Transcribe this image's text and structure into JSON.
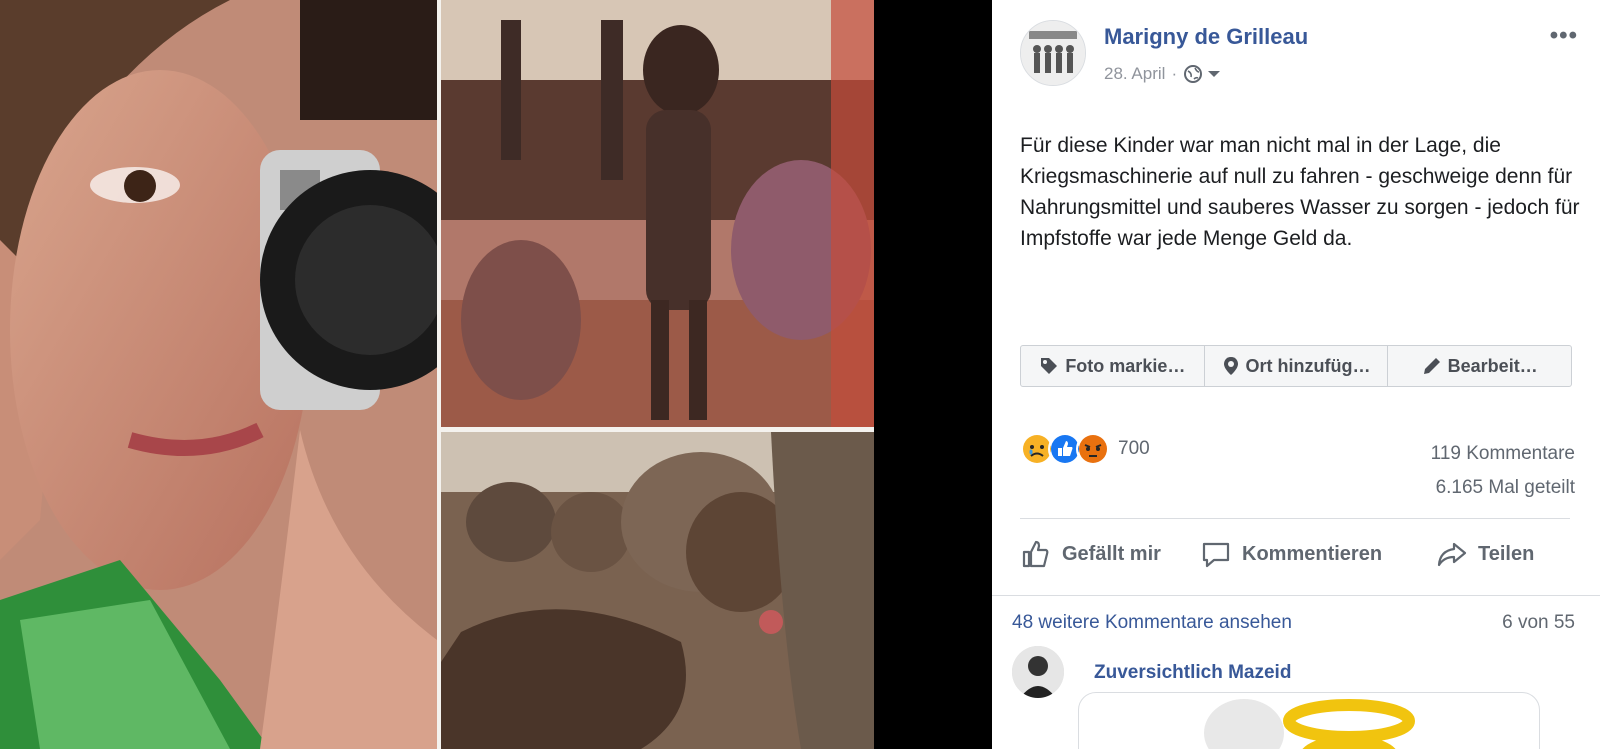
{
  "post": {
    "author": "Marigny de Grilleau",
    "date": "28. April",
    "date_separator": "·",
    "audience_icon": "globe-icon",
    "text": "Für diese Kinder war man nicht mal in der Lage, die Kriegsmaschinerie auf null zu fahren - geschweige denn für Nahrungsmittel und sauberes Wasser zu sorgen - jedoch für Impfstoffe war jede Menge Geld da."
  },
  "photo_actions": [
    {
      "label": "Foto markie…",
      "icon": "tag-icon"
    },
    {
      "label": "Ort hinzufüg…",
      "icon": "location-pin-icon"
    },
    {
      "label": "Bearbeit…",
      "icon": "pencil-icon"
    }
  ],
  "reactions": {
    "icons": [
      "sad-reaction-icon",
      "like-reaction-icon",
      "angry-reaction-icon"
    ],
    "count": "700"
  },
  "stats": {
    "comments": "119 Kommentare",
    "shares": "6.165 Mal geteilt"
  },
  "action_bar": {
    "like": "Gefällt mir",
    "comment": "Kommentieren",
    "share": "Teilen"
  },
  "comments": {
    "more_link": "48 weitere Kommentare ansehen",
    "count": "6 von 55",
    "first_author": "Zuversichtlich Mazeid"
  },
  "colors": {
    "link_blue": "#385898",
    "text": "#1c1e21",
    "muted": "#90949c",
    "like_blue": "#1877f2",
    "angry_orange": "#e9710f",
    "sad_yellow": "#f7b125"
  }
}
